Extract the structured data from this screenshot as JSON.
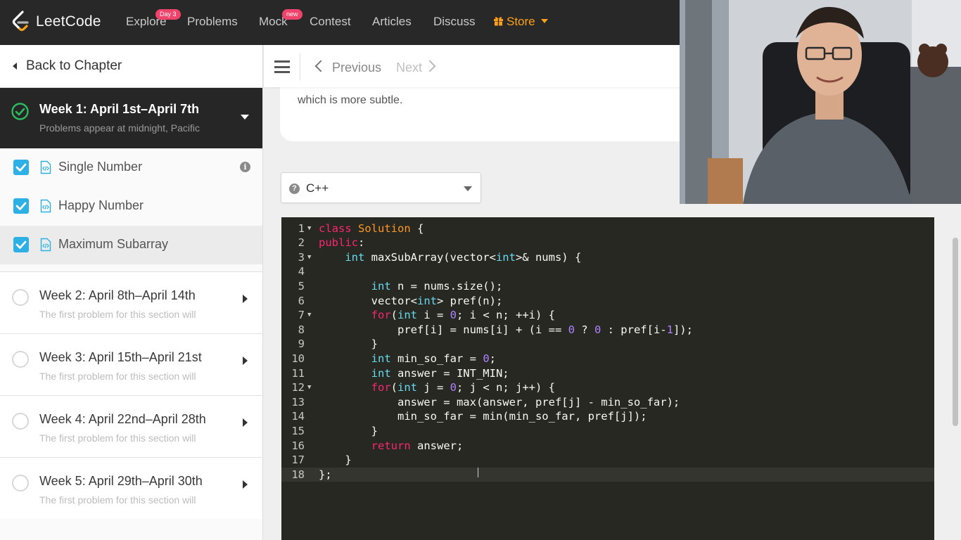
{
  "nav": {
    "brand": "LeetCode",
    "items": [
      {
        "label": "Explore",
        "badge": "Day 3"
      },
      {
        "label": "Problems"
      },
      {
        "label": "Mock",
        "badge": "new"
      },
      {
        "label": "Contest"
      },
      {
        "label": "Articles"
      },
      {
        "label": "Discuss"
      }
    ],
    "store": {
      "label": "Store",
      "icon": "gift-icon"
    }
  },
  "sidebar": {
    "back": "Back to Chapter",
    "active_week": {
      "title": "Week 1: April 1st–April 7th",
      "subtitle": "Problems appear at midnight, Pacific",
      "icon": "check-circle-icon"
    },
    "problems": [
      {
        "label": "Single Number",
        "checked": true
      },
      {
        "label": "Happy Number",
        "checked": true
      },
      {
        "label": "Maximum Subarray",
        "checked": true,
        "selected": true
      }
    ],
    "weeks": [
      {
        "title": "Week 2: April 8th–April 14th",
        "subtitle": "The first problem for this section will"
      },
      {
        "title": "Week 3: April 15th–April 21st",
        "subtitle": "The first problem for this section will"
      },
      {
        "title": "Week 4: April 22nd–April 28th",
        "subtitle": "The first problem for this section will"
      },
      {
        "title": "Week 5: April 29th–April 30th",
        "subtitle": "The first problem for this section will"
      }
    ]
  },
  "toolbar": {
    "previous": "Previous",
    "next": "Next"
  },
  "description": {
    "visible_text": "which is more subtle."
  },
  "language": {
    "selected": "C++"
  },
  "editor": {
    "lines": [
      "class Solution {",
      "public:",
      "    int maxSubArray(vector<int>& nums) {",
      "",
      "        int n = nums.size();",
      "        vector<int> pref(n);",
      "        for(int i = 0; i < n; ++i) {",
      "            pref[i] = nums[i] + (i == 0 ? 0 : pref[i-1]);",
      "        }",
      "        int min_so_far = 0;",
      "        int answer = INT_MIN;",
      "        for(int j = 0; j < n; j++) {",
      "            answer = max(answer, pref[j] - min_so_far);",
      "            min_so_far = min(min_so_far, pref[j]);",
      "        }",
      "        return answer;",
      "    }",
      "};"
    ],
    "folded_lines": [
      1,
      3,
      7,
      12
    ],
    "active_line": 18
  },
  "colors": {
    "nav_bg": "#282828",
    "accent_orange": "#ffa116",
    "badge_pink": "#f0436b",
    "check_blue": "#2db0e6",
    "success_green": "#2cbb5d",
    "editor_bg": "#272822"
  }
}
